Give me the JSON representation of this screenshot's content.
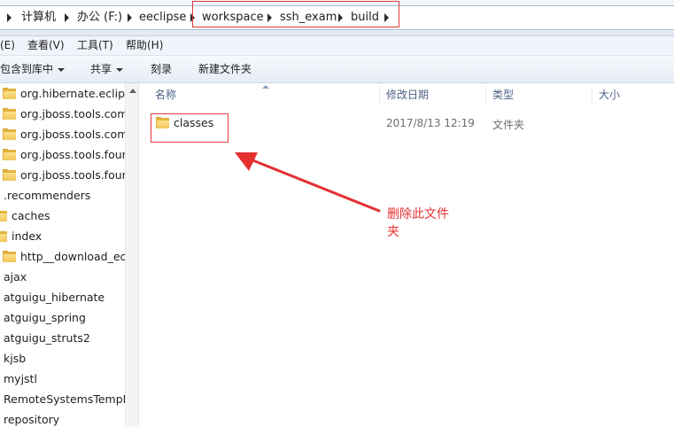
{
  "address_bar": {
    "crumbs": [
      "计算机",
      "办公 (F:)",
      "eeclipse",
      "workspace",
      "ssh_exam",
      "build"
    ]
  },
  "menu": [
    "(E)",
    "查看(V)",
    "工具(T)",
    "帮助(H)"
  ],
  "toolbar": {
    "include_in_library": "包含到库中",
    "share": "共享",
    "burn": "刻录",
    "new_folder": "新建文件夹"
  },
  "nav_items": [
    {
      "label": "org.hibernate.eclipse",
      "icon": "folder-icon"
    },
    {
      "label": "org.jboss.tools.comm",
      "icon": "folder-icon"
    },
    {
      "label": "org.jboss.tools.comm",
      "icon": "folder-icon"
    },
    {
      "label": "org.jboss.tools.foun",
      "icon": "folder-icon"
    },
    {
      "label": "org.jboss.tools.foun",
      "icon": "folder-icon"
    },
    {
      "label": ".recommenders",
      "icon": ""
    },
    {
      "label": "caches",
      "icon": "folder-icon"
    },
    {
      "label": "index",
      "icon": "folder-icon"
    },
    {
      "label": "http__download_ec",
      "icon": "folder-icon"
    },
    {
      "label": "ajax",
      "icon": ""
    },
    {
      "label": "atguigu_hibernate",
      "icon": ""
    },
    {
      "label": "atguigu_spring",
      "icon": ""
    },
    {
      "label": "atguigu_struts2",
      "icon": ""
    },
    {
      "label": "kjsb",
      "icon": ""
    },
    {
      "label": "myjstl",
      "icon": ""
    },
    {
      "label": "RemoteSystemsTempFi",
      "icon": ""
    },
    {
      "label": "repository",
      "icon": ""
    }
  ],
  "columns": {
    "name": "名称",
    "modified": "修改日期",
    "type": "类型",
    "size": "大小"
  },
  "files": [
    {
      "name": "classes",
      "modified": "2017/8/13 12:19",
      "type": "文件夹",
      "size": ""
    }
  ],
  "annotation": {
    "text": "删除此文件夹",
    "color": "#e53030"
  },
  "colors": {
    "highlight": "#e03a3a",
    "header_text": "#4d6185",
    "folder": "#f1c659"
  }
}
